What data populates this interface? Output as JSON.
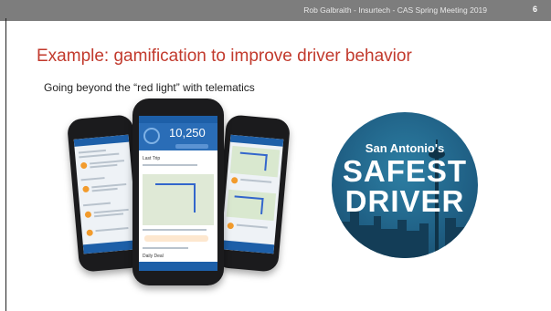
{
  "header": {
    "text": "Rob Galbraith - Insurtech - CAS Spring Meeting 2019",
    "page_number": "6"
  },
  "title": "Example: gamification to improve driver behavior",
  "subtitle": "Going beyond the “red light” with telematics",
  "phones": {
    "center": {
      "score": "10,250",
      "section_title": "Last Trip",
      "bottom_card": "Daily Deal"
    }
  },
  "logo": {
    "line1": "San Antonio's",
    "line2": "SAFEST",
    "line3": "DRIVER"
  },
  "colors": {
    "title": "#c23a2d",
    "header_bar": "#7d7d7d",
    "app_blue": "#1d5fa8",
    "logo_blue": "#1f5f84"
  }
}
